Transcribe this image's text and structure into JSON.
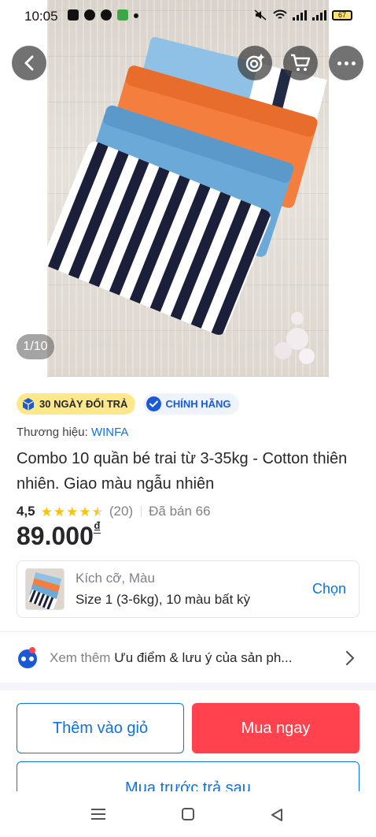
{
  "status_bar": {
    "time": "10:05",
    "battery": "67"
  },
  "gallery": {
    "counter": "1/10"
  },
  "badges": {
    "return_policy": "30 NGÀY ĐỔI TRẢ",
    "genuine": "CHÍNH HÃNG"
  },
  "brand": {
    "label": "Thương hiệu:",
    "name": "WINFA"
  },
  "product": {
    "title": "Combo 10 quần bé trai từ 3-35kg - Cotton thiên nhiên. Giao màu ngẫu nhiên",
    "rating": "4,5",
    "stars": 4.5,
    "review_count": "(20)",
    "sold": "Đã bán 66",
    "price": "89.000",
    "currency": "₫"
  },
  "variant": {
    "label": "Kích cỡ, Màu",
    "value": "Size 1 (3-6kg), 10 màu bất kỳ",
    "action": "Chọn"
  },
  "see_more": {
    "prefix": "Xem thêm",
    "text": "Ưu điểm & lưu ý của sản ph..."
  },
  "actions": {
    "add_to_cart": "Thêm vào giỏ",
    "buy_now": "Mua ngay",
    "buy_later": "Mua trước trả sau"
  },
  "colors": {
    "accent_blue": "#0b74e5",
    "buy_red": "#ff424e",
    "star_yellow": "#ffc400",
    "badge_yellow": "#ffe88a"
  }
}
